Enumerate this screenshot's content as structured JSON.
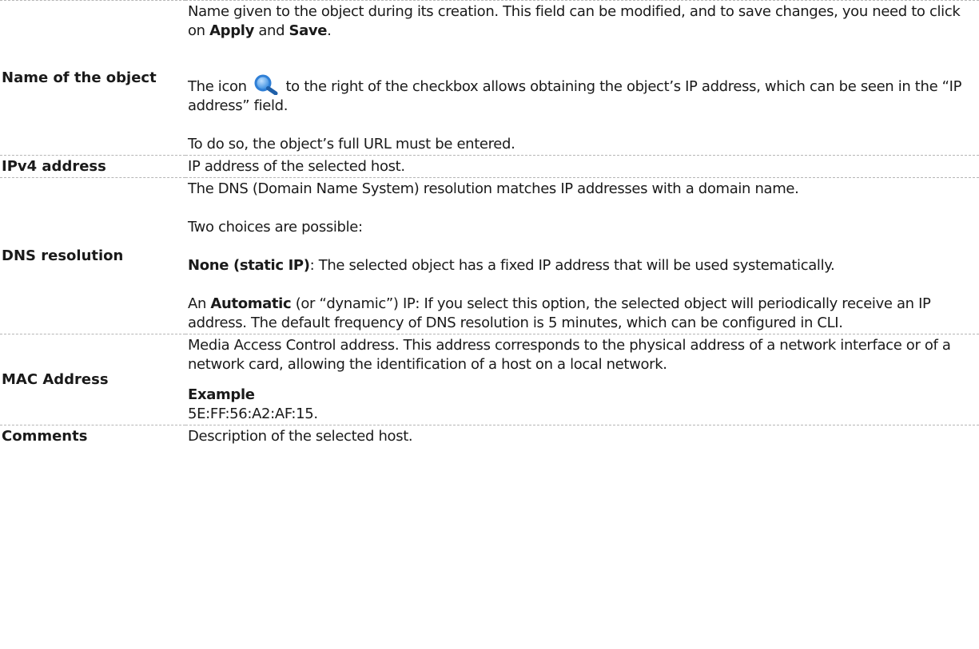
{
  "rows": [
    {
      "term": "Name of the object",
      "p1": {
        "t1": "Name given to the object during its creation. This field can be modified, and to save changes, you need to click on ",
        "b1": "Apply",
        "t2": " and ",
        "b2": "Save",
        "t3": "."
      },
      "p2": {
        "t1": "The icon",
        "icon": "magnifier-icon",
        "t2": "to the right of the checkbox allows obtaining the object’s IP address, which can be seen in the “IP address” field."
      },
      "p3": "To do so, the object’s full URL must be entered."
    },
    {
      "term": "IPv4 address",
      "p1": "IP address of the selected host."
    },
    {
      "term": "DNS resolution",
      "p1": "The DNS (Domain Name System) resolution matches IP addresses with a domain name.",
      "p2": "Two choices are possible:",
      "p3": {
        "b1": "None (static IP)",
        "t1": ": The selected object has a fixed IP address that will be used systematically."
      },
      "p4": {
        "t1": "An ",
        "b1": "Automatic",
        "t2": " (or “dynamic”) IP: If you select this option, the selected object will periodically receive an IP address. The default frequency of DNS resolution is 5 minutes, which can be configured in CLI."
      }
    },
    {
      "term": "MAC Address",
      "p1": "Media Access Control address. This address corresponds to the physical address of a network interface or of a network card, allowing the identification of a host on a local network.",
      "example_title": "Example",
      "example_value": "5E:FF:56:A2:AF:15."
    },
    {
      "term": "Comments",
      "p1": "Description of the selected host."
    }
  ],
  "colors": {
    "text": "#1a1a1a",
    "separator": "#b6b6b6",
    "icon_blue": "#2f7fd6",
    "icon_handle": "#1f5fa8"
  }
}
